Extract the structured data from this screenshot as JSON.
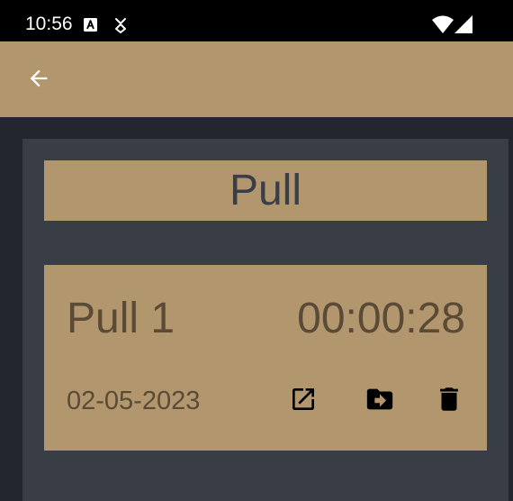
{
  "status_bar": {
    "time": "10:56",
    "icons": [
      "autofill-a-icon",
      "data-saver-icon",
      "wifi-icon",
      "cell-signal-icon"
    ]
  },
  "app_bar": {
    "back_icon": "arrow-back-icon"
  },
  "workout": {
    "title": "Pull"
  },
  "session": {
    "name": "Pull 1",
    "duration": "00:00:28",
    "date": "02-05-2023",
    "actions": [
      "open-in-new-icon",
      "drive-file-move-icon",
      "delete-icon"
    ]
  },
  "colors": {
    "accent": "#b2966e",
    "background": "#23262e",
    "panel": "#383d46",
    "title_text": "#3a3f47",
    "card_text": "#5a4a36"
  }
}
